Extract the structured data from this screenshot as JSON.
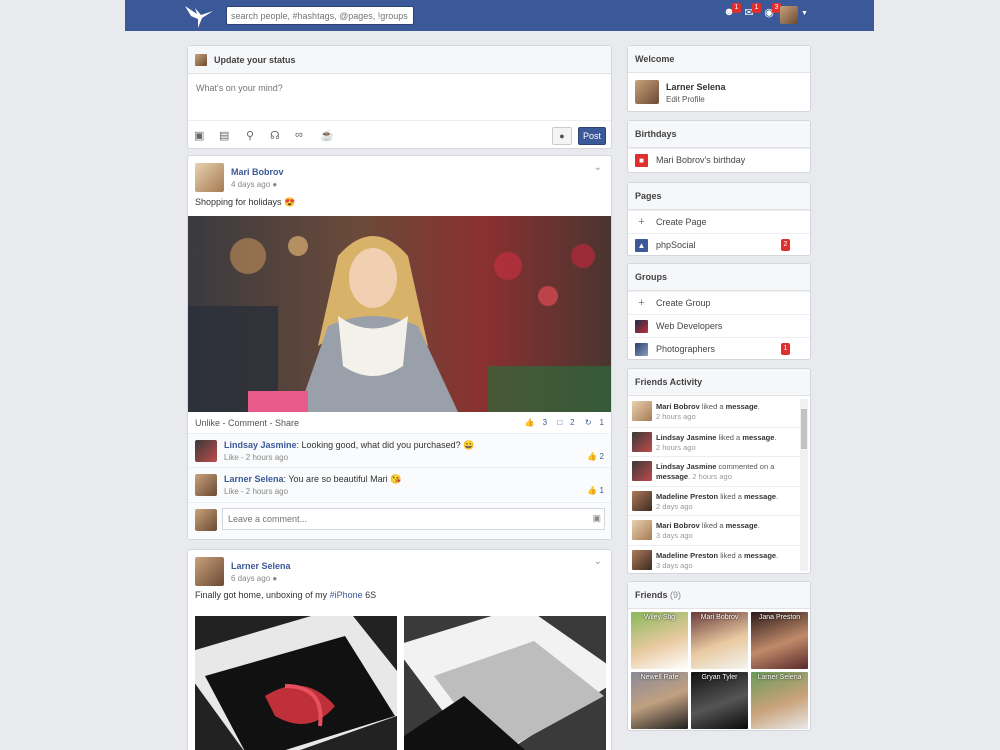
{
  "header": {
    "search_placeholder": "search people, #hashtags, @pages, !groups",
    "notifications": [
      {
        "icon": "friend-request-icon",
        "count": "1"
      },
      {
        "icon": "message-icon",
        "count": "1"
      },
      {
        "icon": "notification-icon",
        "count": "3"
      }
    ]
  },
  "status_box": {
    "title": "Update your status",
    "placeholder": "What's on your mind?",
    "post_label": "Post",
    "tools": [
      "camera-icon",
      "film-icon",
      "location-icon",
      "headphones-icon",
      "glasses-icon",
      "food-icon"
    ]
  },
  "posts": [
    {
      "author": "Mari Bobrov",
      "time": "4 days ago",
      "text": "Shopping for holidays",
      "text_emoji": "😍",
      "actions": "Unlike - Comment - Share",
      "likes": "3",
      "comments": "2",
      "shares": "1",
      "comments_list": [
        {
          "author": "Lindsay Jasmine",
          "text": ": Looking good, what did you purchased?",
          "emoji": "😀",
          "meta": "Like - 2 hours ago",
          "likes": "2"
        },
        {
          "author": "Larner Selena",
          "text": ": You are so beautiful Mari",
          "emoji": "😘",
          "meta": "Like - 2 hours ago",
          "likes": "1"
        }
      ],
      "comment_placeholder": "Leave a comment..."
    },
    {
      "author": "Larner Selena",
      "time": "6 days ago",
      "text": "Finally got home, unboxing of my ",
      "hashtag": "#iPhone",
      "text_after": " 6S"
    }
  ],
  "sidebar": {
    "welcome": {
      "title": "Welcome",
      "name": "Larner Selena",
      "edit": "Edit Profile"
    },
    "birthdays": {
      "title": "Birthdays",
      "items": [
        "Mari Bobrov's birthday"
      ]
    },
    "pages": {
      "title": "Pages",
      "create": "Create Page",
      "items": [
        {
          "name": "phpSocial",
          "count": "2"
        }
      ]
    },
    "groups": {
      "title": "Groups",
      "create": "Create Group",
      "items": [
        {
          "name": "Web Developers"
        },
        {
          "name": "Photographers",
          "count": "1"
        }
      ]
    },
    "activity": {
      "title": "Friends Activity",
      "items": [
        {
          "name": "Mari Bobrov",
          "verb": " liked a ",
          "obj": "message",
          "time": "2 hours ago"
        },
        {
          "name": "Lindsay Jasmine",
          "verb": " liked a ",
          "obj": "message",
          "time": "2 hours ago"
        },
        {
          "name": "Lindsay Jasmine",
          "verb": " commented on a ",
          "obj": "message",
          "time": "2 hours ago"
        },
        {
          "name": "Madeline Preston",
          "verb": " liked a ",
          "obj": "message",
          "time": "2 days ago"
        },
        {
          "name": "Mari Bobrov",
          "verb": " liked a ",
          "obj": "message",
          "time": "3 days ago"
        },
        {
          "name": "Madeline Preston",
          "verb": " liked a ",
          "obj": "message",
          "time": "3 days ago"
        }
      ]
    },
    "friends": {
      "title": "Friends",
      "count": "(9)",
      "names": [
        "Wiley Stig",
        "Mari Bobrov",
        "Jana Preston",
        "Newell Rafe",
        "Gryan Tyler",
        "Larner Selena"
      ]
    }
  },
  "colors": {
    "brand": "#3b5998",
    "badge": "#e02f2f",
    "background": "#e9eaed"
  }
}
